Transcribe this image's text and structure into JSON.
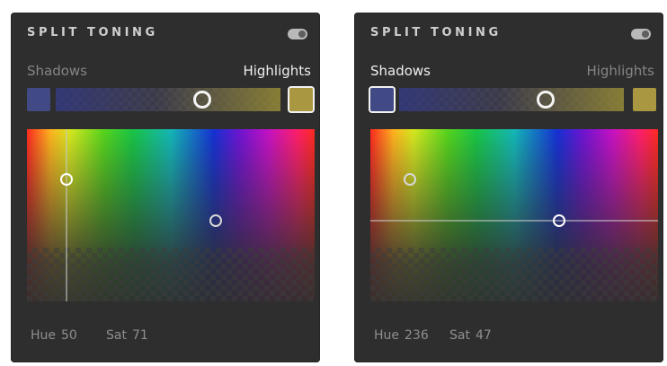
{
  "panels": [
    {
      "title": "SPLIT TONING",
      "tabs": {
        "left": "Shadows",
        "right": "Highlights",
        "active": "Highlights"
      },
      "colors": {
        "shadows": "#424a86",
        "highlights": "#a99841"
      },
      "balance": 0.65,
      "shadow_handle": {
        "hue": 236,
        "sat": 47
      },
      "highlight_handle": {
        "hue": 50,
        "sat": 71
      },
      "readout": {
        "hue_label": "Hue",
        "hue": "50",
        "sat_label": "Sat",
        "sat": "71"
      }
    },
    {
      "title": "SPLIT TONING",
      "tabs": {
        "left": "Shadows",
        "right": "Highlights",
        "active": "Shadows"
      },
      "colors": {
        "shadows": "#424a86",
        "highlights": "#a99841"
      },
      "balance": 0.65,
      "shadow_handle": {
        "hue": 236,
        "sat": 47
      },
      "highlight_handle": {
        "hue": 50,
        "sat": 71
      },
      "readout": {
        "hue_label": "Hue",
        "hue": "236",
        "sat_label": "Sat",
        "sat": "47"
      }
    }
  ]
}
